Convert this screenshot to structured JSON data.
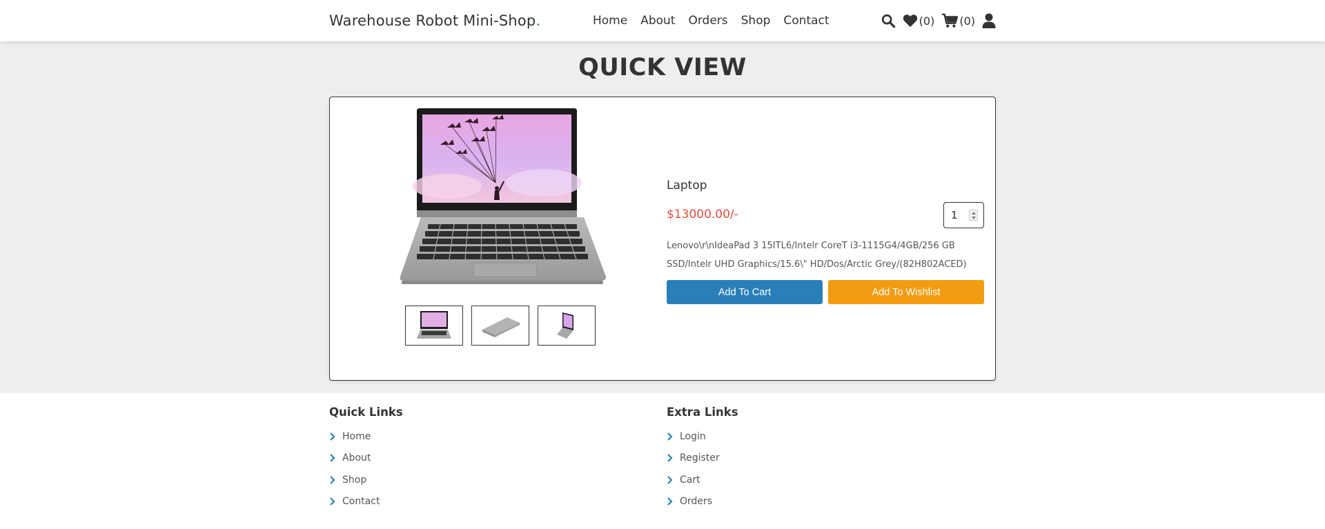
{
  "header": {
    "logo_text": "Warehouse Robot Mini-Shop",
    "logo_dot": ".",
    "nav": [
      "Home",
      "About",
      "Orders",
      "Shop",
      "Contact"
    ],
    "wishlist_count": "(0)",
    "cart_count": "(0)",
    "icons": [
      "search-icon",
      "heart-icon",
      "cart-icon",
      "user-icon"
    ]
  },
  "quick_view": {
    "title": "QUICK VIEW",
    "product": {
      "name": "Laptop",
      "price": "$13000.00/-",
      "quantity": "1",
      "description": "Lenovo\\r\\nIdeaPad 3 15ITL6/Intelr CoreT i3-1115G4/4GB/256 GB SSD/Intelr UHD Graphics/15.6\\\" HD/Dos/Arctic Grey/(82H802ACED)"
    },
    "buttons": {
      "add_to_cart": "Add To Cart",
      "add_to_wishlist": "Add To Wishlist"
    }
  },
  "footer": {
    "quick_links": {
      "title": "Quick Links",
      "items": [
        "Home",
        "About",
        "Shop",
        "Contact"
      ]
    },
    "extra_links": {
      "title": "Extra Links",
      "items": [
        "Login",
        "Register",
        "Cart",
        "Orders"
      ]
    }
  },
  "colors": {
    "accent": "#2980b9",
    "price": "#e74c3c",
    "wishlist_button": "#f39c12",
    "background": "#eeeeee"
  }
}
